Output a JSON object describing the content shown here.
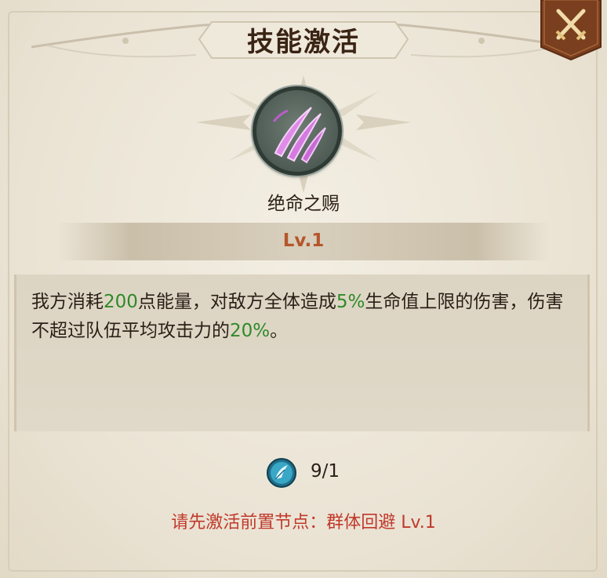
{
  "dialog": {
    "title": "技能激活"
  },
  "close_button": {
    "icon": "crossed-swords-close-icon",
    "color": "#7a3f1e"
  },
  "skill": {
    "icon": "claw-slash-icon",
    "name": "绝命之赐",
    "level": "Lv.1",
    "description": {
      "p1": "我方消耗",
      "energy": "200",
      "p2": "点能量，对敌方全体造成",
      "percent": "5%",
      "p3": "生命值上限的伤害，伤害不超过队伍平均攻击力的",
      "cap": "20%",
      "p4": "。"
    }
  },
  "cost": {
    "icon": "feather-gem-icon",
    "value": "9/1"
  },
  "requirement": "请先激活前置节点：群体回避 Lv.1",
  "colors": {
    "highlight_green": "#2e8a2a",
    "level_orange": "#b5562a",
    "warning_red": "#c0392b"
  }
}
